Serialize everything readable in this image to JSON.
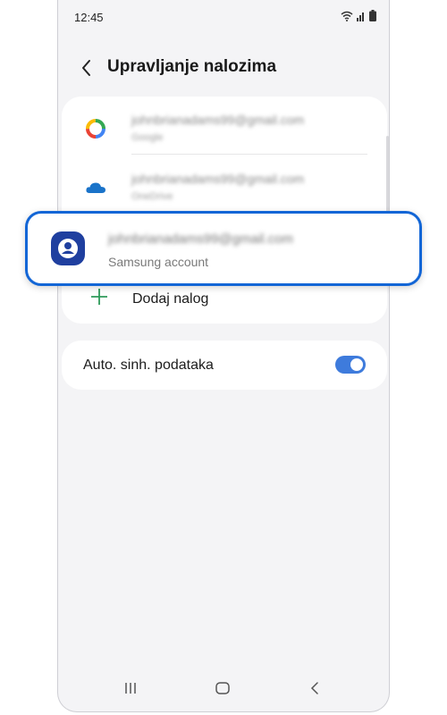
{
  "status_bar": {
    "time": "12:45",
    "icons": [
      "wifi-icon",
      "signal-icon",
      "battery-icon"
    ]
  },
  "header": {
    "back_icon": "chevron-left-icon",
    "title": "Upravljanje nalozima"
  },
  "accounts": [
    {
      "email": "johnbrianadams99@gmail.com",
      "type": "Google",
      "icon": "google-icon"
    },
    {
      "email": "johnbrianadams99@gmail.com",
      "type": "OneDrive",
      "icon": "onedrive-cloud-icon"
    }
  ],
  "highlighted_account": {
    "email": "johnbrianadams99@gmail.com",
    "type": "Samsung account",
    "icon": "samsung-account-icon"
  },
  "add_account": {
    "label": "Dodaj nalog",
    "icon": "plus-icon"
  },
  "auto_sync": {
    "label": "Auto. sinh. podataka",
    "enabled": true
  },
  "nav_bar": {
    "icons": [
      "recent-apps-icon",
      "home-icon",
      "back-icon"
    ]
  },
  "colors": {
    "accent": "#1366d6",
    "toggle_on": "#3e7bdc",
    "add_icon": "#2e9a5a",
    "samsung_icon": "#1f3f9f",
    "background": "#f4f4f6"
  }
}
